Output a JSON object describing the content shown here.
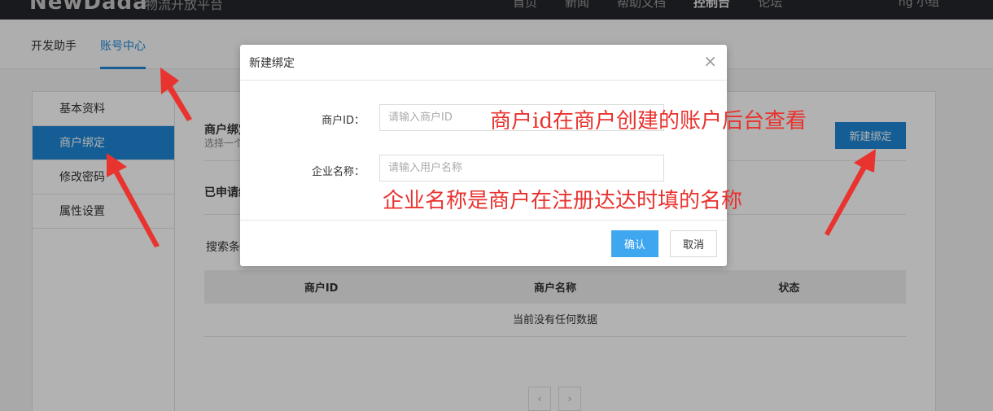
{
  "topbar": {
    "logo": "NewDada",
    "subtitle": "物流开放平台",
    "nav": [
      "首页",
      "新闻",
      "帮助文档",
      "控制台",
      "论坛"
    ],
    "user": "ng 小组"
  },
  "subnav": {
    "tabs": [
      "开发助手",
      "账号中心"
    ]
  },
  "sidebar": {
    "items": [
      "基本资料",
      "商户绑定",
      "修改密码",
      "属性设置"
    ]
  },
  "main": {
    "section_title": "商户绑定",
    "section_desc": "选择一个",
    "new_button": "新建绑定",
    "applied_title": "已申请绑定",
    "search_label": "搜索条件",
    "table": {
      "headers": [
        "商户ID",
        "商户名称",
        "状态"
      ],
      "empty": "当前没有任何数据"
    },
    "pager": {
      "prev": "‹",
      "next": "›"
    }
  },
  "modal": {
    "title": "新建绑定",
    "close": "×",
    "fields": [
      {
        "label": "商户ID：",
        "placeholder": "请输入商户ID",
        "value": ""
      },
      {
        "label": "企业名称：",
        "placeholder": "请输入用户名称",
        "value": ""
      }
    ],
    "ok": "确认",
    "cancel": "取消"
  },
  "annotations": {
    "merchant_id_note": "商户id在商户创建的账户后台查看",
    "company_name_note": "企业名称是商户在注册达达时填的名称",
    "color": "#e8332f"
  }
}
